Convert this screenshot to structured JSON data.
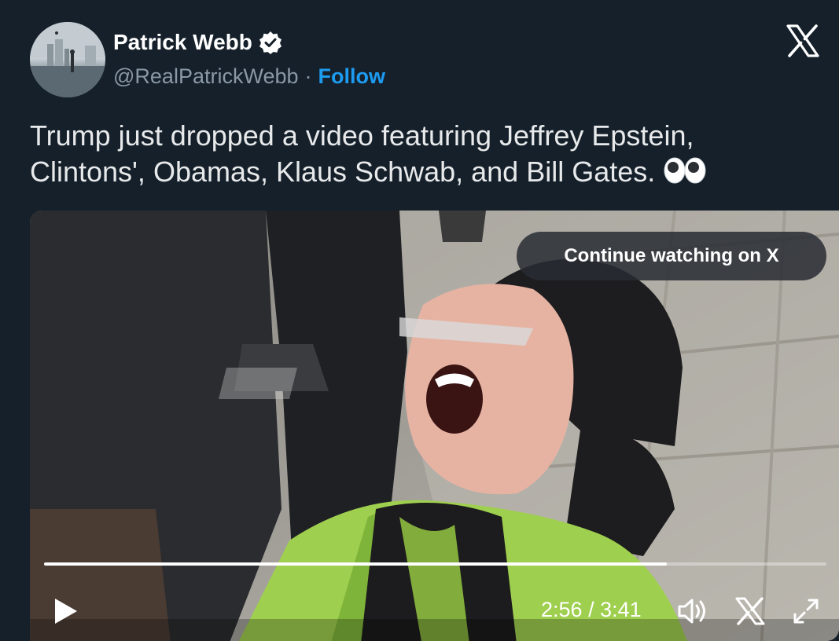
{
  "author": {
    "name": "Patrick Webb",
    "handle": "@RealPatrickWebb",
    "separator": "·",
    "follow_label": "Follow"
  },
  "tweet": {
    "text": "Trump just dropped a video featuring Jeffrey Epstein, Clintons', Obamas, Klaus Schwab, and Bill Gates."
  },
  "video": {
    "continue_label": "Continue watching on X",
    "current_time": "2:56",
    "time_separator": "/",
    "duration": "3:41",
    "progress_fraction": 0.796
  },
  "icons": {
    "verified": "verified-badge-icon",
    "logo": "x-logo-icon",
    "eyes": "eyes-emoji-icon",
    "play": "play-icon",
    "volume": "volume-icon",
    "x_small": "x-logo-icon",
    "fullscreen": "fullscreen-icon"
  },
  "colors": {
    "background": "#15202b",
    "follow": "#1d9bf0",
    "handle": "#8b98a5",
    "text": "#e7e9ea"
  }
}
